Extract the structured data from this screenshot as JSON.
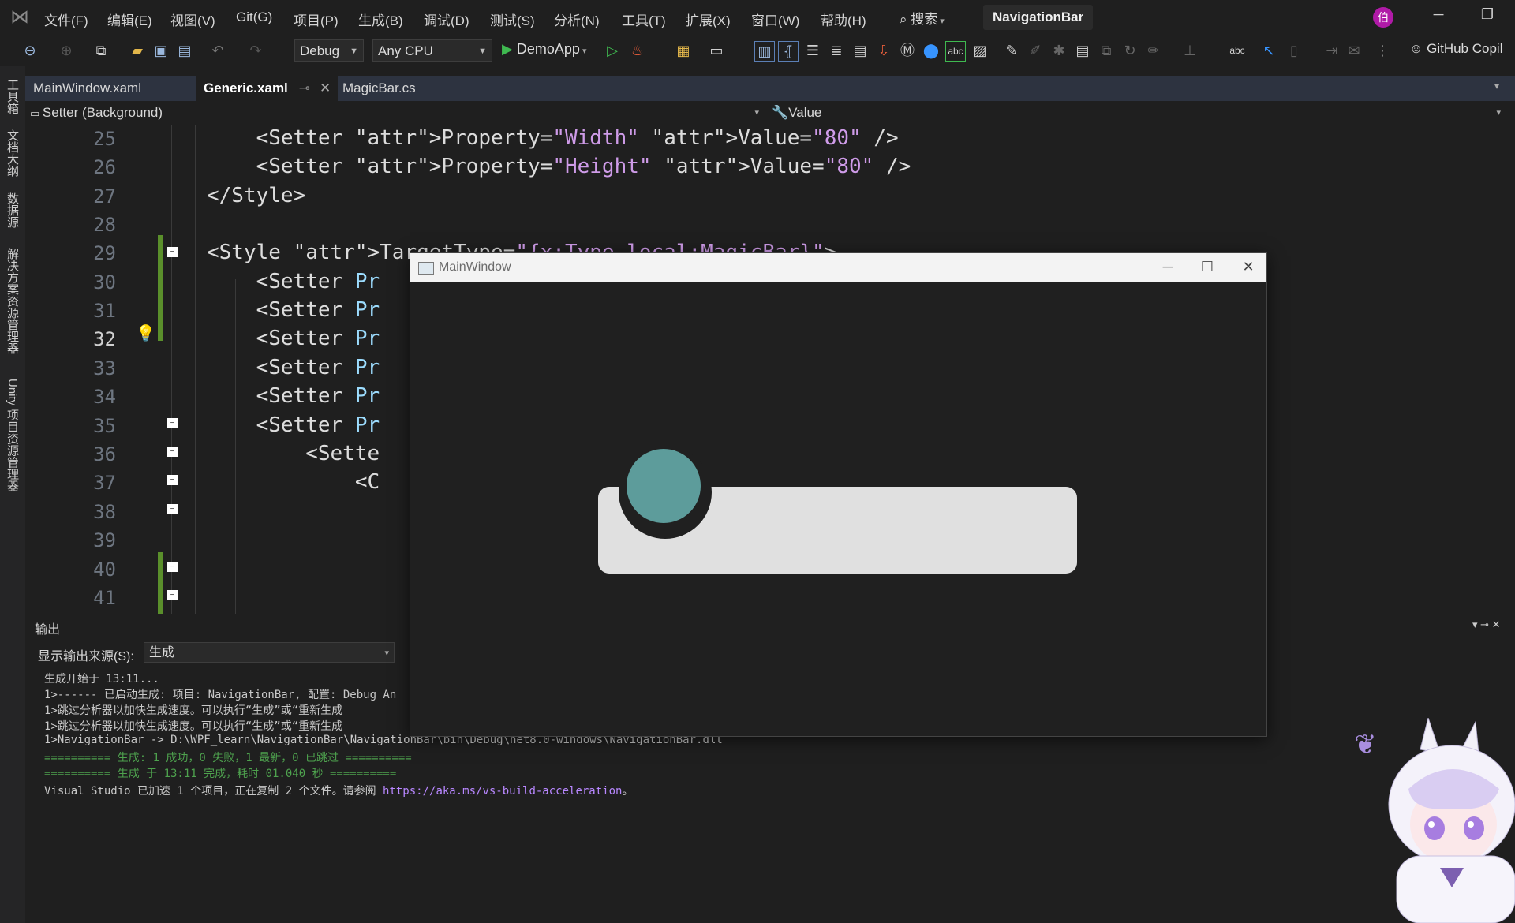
{
  "menu": {
    "items": [
      "文件(F)",
      "编辑(E)",
      "视图(V)",
      "Git(G)",
      "项目(P)",
      "生成(B)",
      "调试(D)",
      "测试(S)",
      "分析(N)",
      "工具(T)",
      "扩展(X)",
      "窗口(W)",
      "帮助(H)"
    ],
    "search_label": "搜索",
    "solution_name": "NavigationBar",
    "avatar_initial": "伯"
  },
  "toolbar": {
    "config": "Debug",
    "platform": "Any CPU",
    "startup": "DemoApp",
    "copilot": "GitHub Copil"
  },
  "left_strip": [
    "工具箱",
    "文档大纲",
    "数据源",
    "解决方案资源管理器",
    "Unity 项目资源管理器"
  ],
  "tabs": [
    {
      "label": "MainWindow.xaml",
      "active": false
    },
    {
      "label": "Generic.xaml",
      "active": true
    },
    {
      "label": "MagicBar.cs",
      "active": false
    }
  ],
  "nav": {
    "element": "Setter (Background)",
    "member": "Value"
  },
  "editor": {
    "lines": [
      {
        "no": "25",
        "code": "    <Setter Property=\"Width\" Value=\"80\" />"
      },
      {
        "no": "26",
        "code": "    <Setter Property=\"Height\" Value=\"80\" />"
      },
      {
        "no": "27",
        "code": "</Style>"
      },
      {
        "no": "28",
        "code": ""
      },
      {
        "no": "29",
        "code": "<Style TargetType=\"{x:Type local:MagicBar}\">"
      },
      {
        "no": "30",
        "code": "    <Setter Pr"
      },
      {
        "no": "31",
        "code": "    <Setter Pr"
      },
      {
        "no": "32",
        "code": "    <Setter Pr"
      },
      {
        "no": "33",
        "code": "    <Setter Pr"
      },
      {
        "no": "34",
        "code": "    <Setter Pr"
      },
      {
        "no": "35",
        "code": "    <Setter Pr"
      },
      {
        "no": "36",
        "code": "        <Sette"
      },
      {
        "no": "37",
        "code": "            <C"
      },
      {
        "no": "38",
        "code": ""
      },
      {
        "no": "39",
        "code": ""
      },
      {
        "no": "40",
        "code": ""
      },
      {
        "no": "41",
        "code": ""
      }
    ]
  },
  "output": {
    "title": "输出",
    "source_label": "显示输出来源(S):",
    "source_value": "生成",
    "lines": [
      "生成开始于 13:11...",
      "1>------ 已启动生成: 项目: NavigationBar, 配置: Debug An",
      "1>跳过分析器以加快生成速度。可以执行“生成”或“重新生成",
      "1>跳过分析器以加快生成速度。可以执行“生成”或“重新生成",
      "1>NavigationBar -> D:\\WPF_learn\\NavigationBar\\NavigationBar\\bin\\Debug\\net8.0-windows\\NavigationBar.dll",
      "========== 生成: 1 成功，0 失败，1 最新，0 已跳过 ==========",
      "========== 生成 于 13:11 完成，耗时 01.040 秒 =========="
    ],
    "last_line_prefix": "Visual Studio 已加速 1 个项目，正在复制 2 个文件。请参阅 ",
    "last_line_link": "https://aka.ms/vs-build-acceleration",
    "last_line_suffix": "。"
  },
  "main_window": {
    "title": "MainWindow"
  },
  "colors": {
    "magic_circle": "#5d9c9b",
    "magic_bar": "#e0e0e0",
    "window_bg": "#202020",
    "ide_bg": "#1f1f1f"
  }
}
